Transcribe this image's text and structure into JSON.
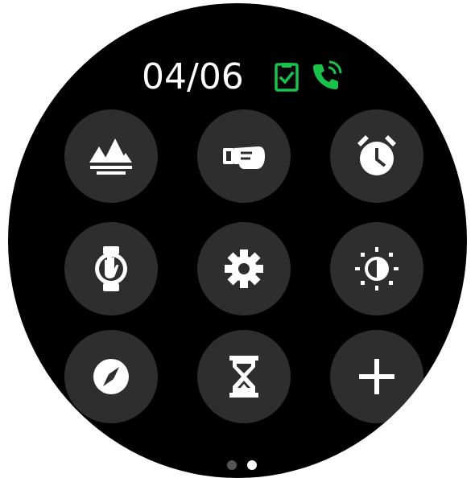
{
  "status": {
    "date": "04/06",
    "icons": [
      "clipboard-check-icon",
      "phone-call-icon"
    ],
    "accent_color": "#19c24a"
  },
  "tiles": [
    {
      "name": "photos-tile",
      "icon": "mountains-landscape-icon"
    },
    {
      "name": "remote-camera-tile",
      "icon": "fist-gesture-icon"
    },
    {
      "name": "alarm-tile",
      "icon": "alarm-clock-icon"
    },
    {
      "name": "raise-to-wake-tile",
      "icon": "hand-watch-icon"
    },
    {
      "name": "settings-tile",
      "icon": "gear-icon"
    },
    {
      "name": "brightness-tile",
      "icon": "brightness-icon"
    },
    {
      "name": "compass-tile",
      "icon": "compass-icon"
    },
    {
      "name": "timer-tile",
      "icon": "hourglass-icon"
    },
    {
      "name": "add-tile",
      "icon": "plus-icon"
    }
  ],
  "pagination": {
    "total": 2,
    "current": 2,
    "active_color": "#ffffff",
    "inactive_color": "#555555"
  },
  "colors": {
    "background": "#000000",
    "tile": "#2e2e2e",
    "icon": "#ffffff"
  }
}
